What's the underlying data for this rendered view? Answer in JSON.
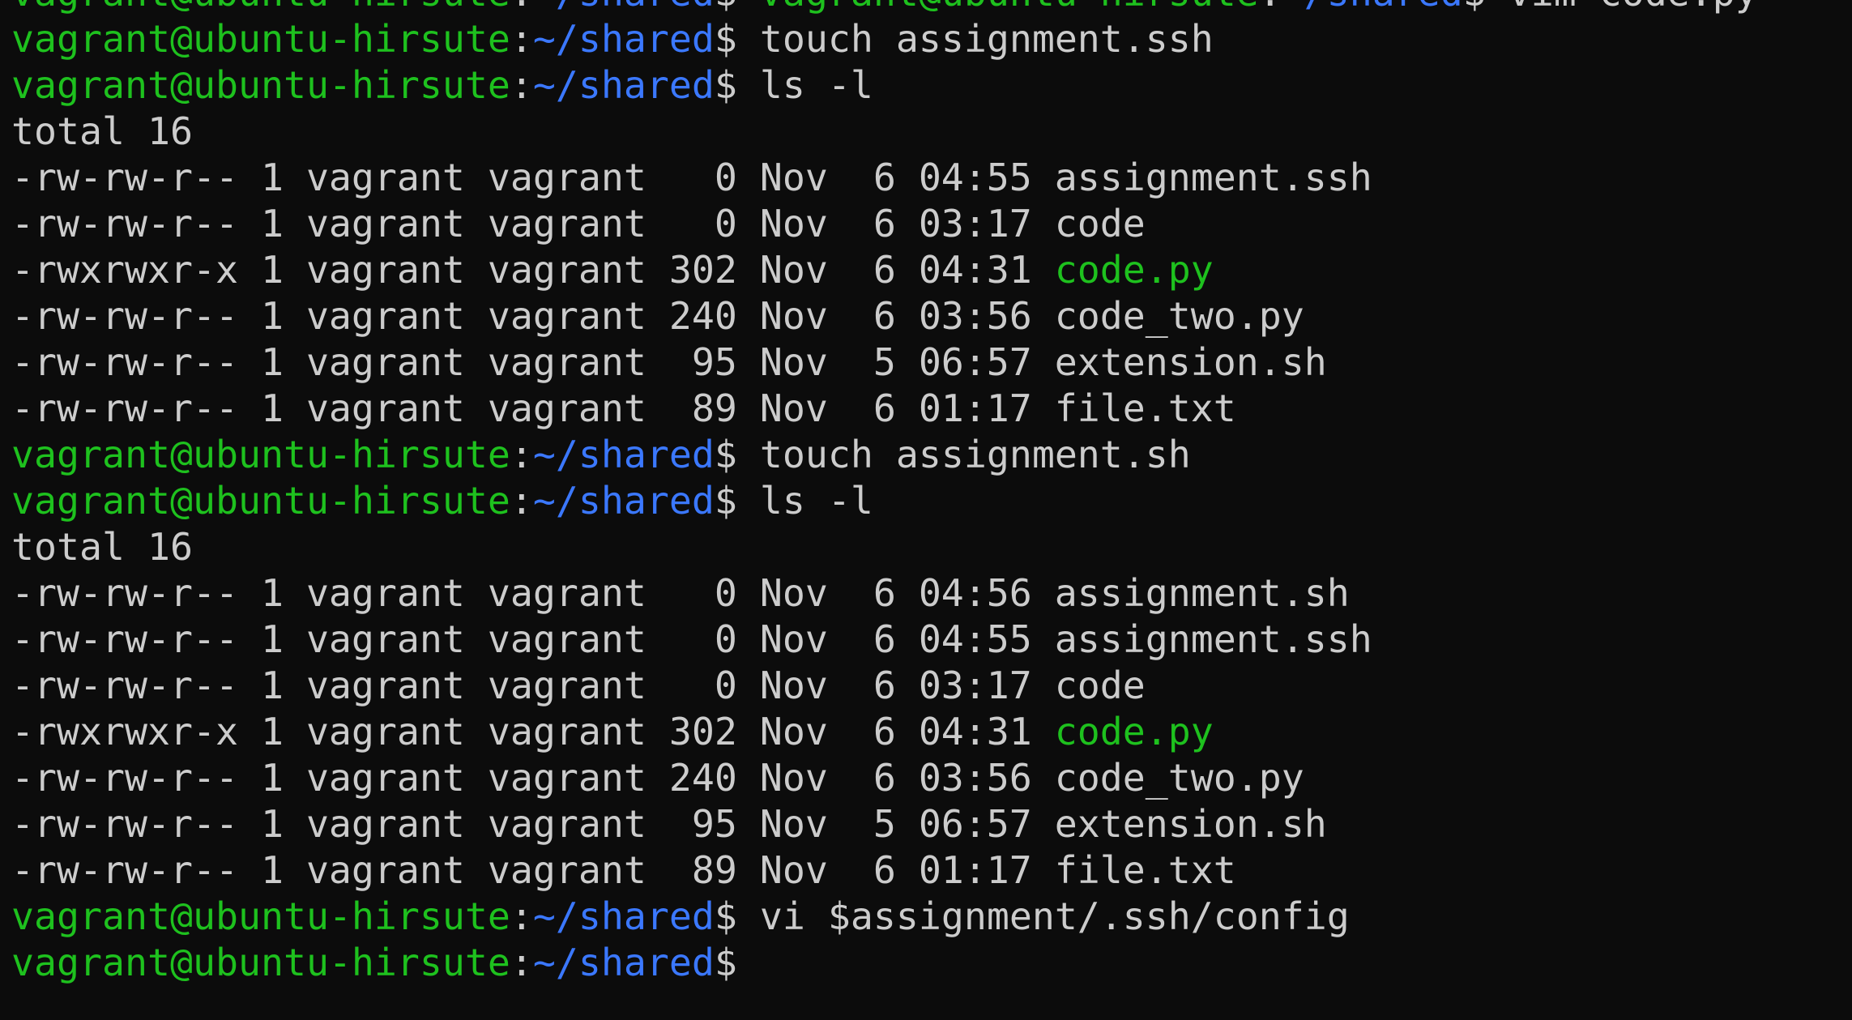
{
  "colors": {
    "background": "#0c0c0c",
    "prompt_user": "#1ec11e",
    "prompt_path": "#3b78ff",
    "text": "#cccccc",
    "executable": "#1ec11e"
  },
  "terminal": {
    "prompt_user": "vagrant@ubuntu-hirsute",
    "prompt_path": "~/shared",
    "lines": [
      {
        "kind": "prompt-pair",
        "cmd": "vagrant@ubuntu-hirsute:~/shared$ vim code.py"
      },
      {
        "kind": "prompt",
        "cmd": "touch assignment.ssh"
      },
      {
        "kind": "prompt",
        "cmd": "ls -l"
      },
      {
        "kind": "text",
        "text": "total 16"
      },
      {
        "kind": "file",
        "meta": "-rw-rw-r-- 1 vagrant vagrant   0 Nov  6 04:55 ",
        "name": "assignment.ssh",
        "exec": false
      },
      {
        "kind": "file",
        "meta": "-rw-rw-r-- 1 vagrant vagrant   0 Nov  6 03:17 ",
        "name": "code",
        "exec": false
      },
      {
        "kind": "file",
        "meta": "-rwxrwxr-x 1 vagrant vagrant 302 Nov  6 04:31 ",
        "name": "code.py",
        "exec": true
      },
      {
        "kind": "file",
        "meta": "-rw-rw-r-- 1 vagrant vagrant 240 Nov  6 03:56 ",
        "name": "code_two.py",
        "exec": false
      },
      {
        "kind": "file",
        "meta": "-rw-rw-r-- 1 vagrant vagrant  95 Nov  5 06:57 ",
        "name": "extension.sh",
        "exec": false
      },
      {
        "kind": "file",
        "meta": "-rw-rw-r-- 1 vagrant vagrant  89 Nov  6 01:17 ",
        "name": "file.txt",
        "exec": false
      },
      {
        "kind": "prompt",
        "cmd": "touch assignment.sh"
      },
      {
        "kind": "prompt",
        "cmd": "ls -l"
      },
      {
        "kind": "text",
        "text": "total 16"
      },
      {
        "kind": "file",
        "meta": "-rw-rw-r-- 1 vagrant vagrant   0 Nov  6 04:56 ",
        "name": "assignment.sh",
        "exec": false
      },
      {
        "kind": "file",
        "meta": "-rw-rw-r-- 1 vagrant vagrant   0 Nov  6 04:55 ",
        "name": "assignment.ssh",
        "exec": false
      },
      {
        "kind": "file",
        "meta": "-rw-rw-r-- 1 vagrant vagrant   0 Nov  6 03:17 ",
        "name": "code",
        "exec": false
      },
      {
        "kind": "file",
        "meta": "-rwxrwxr-x 1 vagrant vagrant 302 Nov  6 04:31 ",
        "name": "code.py",
        "exec": true
      },
      {
        "kind": "file",
        "meta": "-rw-rw-r-- 1 vagrant vagrant 240 Nov  6 03:56 ",
        "name": "code_two.py",
        "exec": false
      },
      {
        "kind": "file",
        "meta": "-rw-rw-r-- 1 vagrant vagrant  95 Nov  5 06:57 ",
        "name": "extension.sh",
        "exec": false
      },
      {
        "kind": "file",
        "meta": "-rw-rw-r-- 1 vagrant vagrant  89 Nov  6 01:17 ",
        "name": "file.txt",
        "exec": false
      },
      {
        "kind": "prompt",
        "cmd": "vi $assignment/.ssh/config"
      },
      {
        "kind": "prompt",
        "cmd": ""
      }
    ]
  }
}
